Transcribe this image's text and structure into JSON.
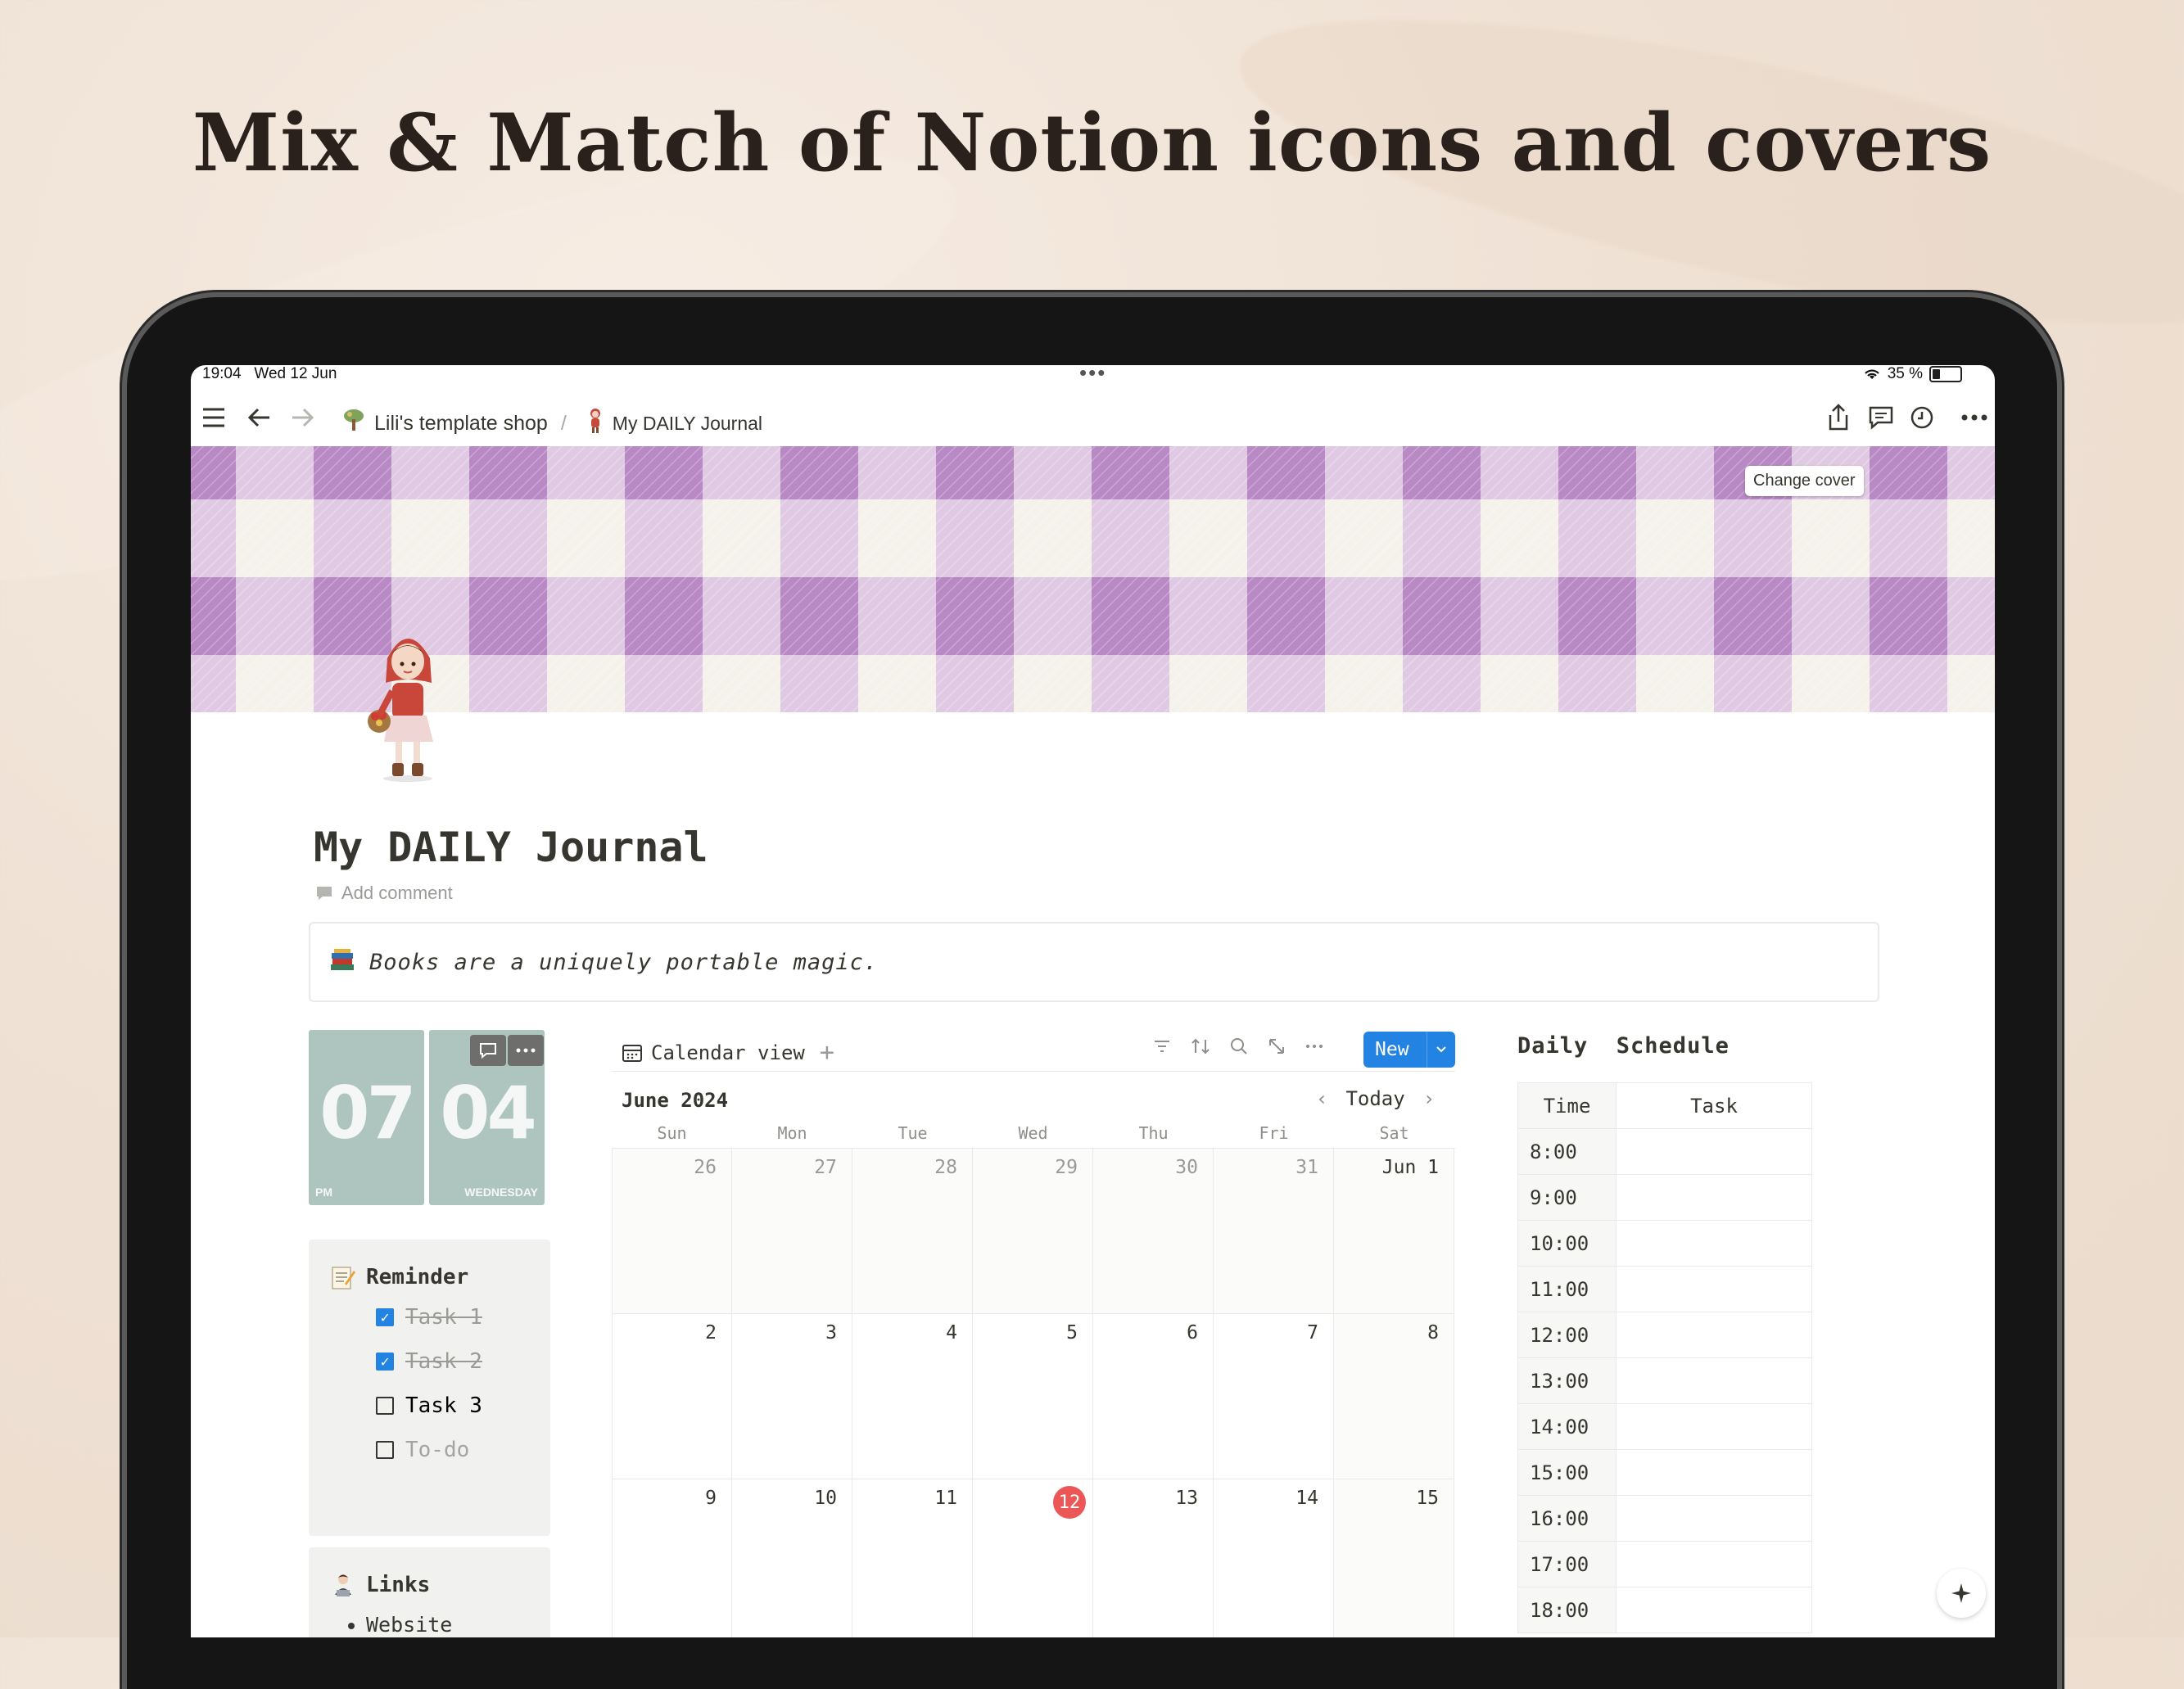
{
  "headline": "Mix & Match of Notion icons and covers",
  "status": {
    "time": "19:04",
    "date": "Wed 12 Jun",
    "battery": "35 %"
  },
  "breadcrumb": {
    "workspace": "Lili's template shop",
    "separator": "/",
    "page": "My DAILY Journal"
  },
  "cover": {
    "change_label": "Change cover",
    "color_dark": "#b889c4",
    "color_light": "#dcc3e2",
    "color_base": "#f4f2ea"
  },
  "page": {
    "title": "My DAILY Journal",
    "add_comment": "Add comment"
  },
  "callout": {
    "emoji": "books-icon",
    "text": "Books are a uniquely portable magic."
  },
  "clock": {
    "hour": "07",
    "minute": "04",
    "ampm": "PM",
    "weekday": "WEDNESDAY",
    "color": "#aec5bf"
  },
  "reminder": {
    "title": "Reminder",
    "items": [
      {
        "label": "Task 1",
        "checked": true
      },
      {
        "label": "Task 2",
        "checked": true
      },
      {
        "label": "Task 3",
        "checked": false
      },
      {
        "label": "To-do",
        "checked": false
      }
    ]
  },
  "links": {
    "title": "Links",
    "items": [
      "Website"
    ]
  },
  "calendar": {
    "view_label": "Calendar view",
    "new_label": "New",
    "month": "June 2024",
    "today_label": "Today",
    "weekdays": [
      "Sun",
      "Mon",
      "Tue",
      "Wed",
      "Thu",
      "Fri",
      "Sat"
    ],
    "weeks": [
      [
        "26",
        "27",
        "28",
        "29",
        "30",
        "31",
        "Jun 1"
      ],
      [
        "2",
        "3",
        "4",
        "5",
        "6",
        "7",
        "8"
      ],
      [
        "9",
        "10",
        "11",
        "12",
        "13",
        "14",
        "15"
      ]
    ],
    "today": "12",
    "accent": "#2383e2",
    "today_color": "#eb5757"
  },
  "schedule": {
    "title": "Daily  Schedule",
    "headers": [
      "Time",
      "Task"
    ],
    "times": [
      "8:00",
      "9:00",
      "10:00",
      "11:00",
      "12:00",
      "13:00",
      "14:00",
      "15:00",
      "16:00",
      "17:00",
      "18:00"
    ]
  }
}
